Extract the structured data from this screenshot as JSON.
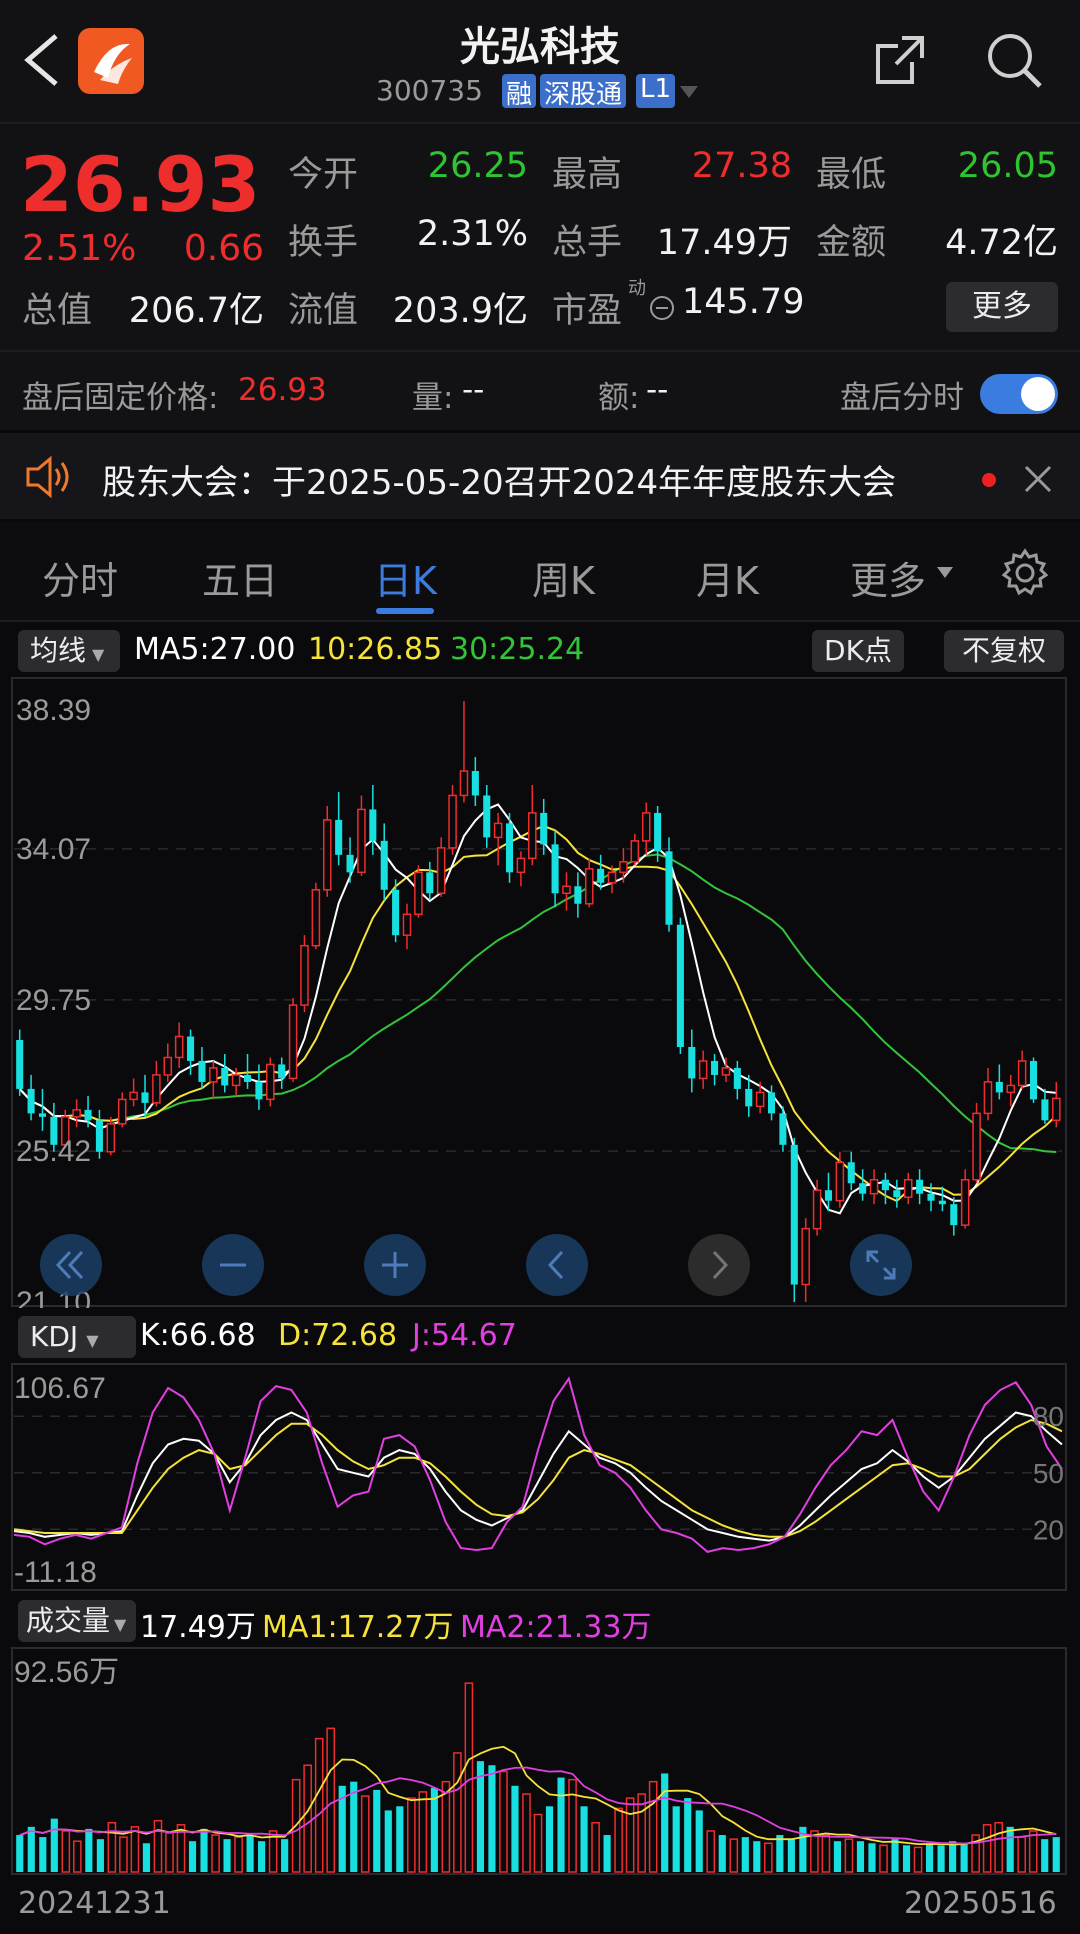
{
  "header": {
    "title": "光弘科技",
    "code": "300735",
    "badges": [
      "融",
      "深股通",
      "L1"
    ]
  },
  "quote": {
    "price": "26.93",
    "change_pct": "2.51%",
    "change": "0.66",
    "open_label": "今开",
    "open": "26.25",
    "high_label": "最高",
    "high": "27.38",
    "low_label": "最低",
    "low": "26.05",
    "turnover_label": "换手",
    "turnover": "2.31%",
    "volume_label": "总手",
    "volume": "17.49万",
    "amount_label": "金额",
    "amount": "4.72亿",
    "mktcap_label": "总值",
    "mktcap": "206.7亿",
    "float_label": "流值",
    "float": "203.9亿",
    "pe_label": "市盈",
    "pe_sup": "动",
    "pe": "145.79",
    "more_button": "更多"
  },
  "afterhours": {
    "price_label": "盘后固定价格:",
    "price": "26.93",
    "vol_label": "量:",
    "vol": "--",
    "amt_label": "额:",
    "amt": "--",
    "toggle_label": "盘后分时",
    "toggle_on": true
  },
  "notice": {
    "text": "股东大会：于2025-05-20召开2024年年度股东大会"
  },
  "tabs": [
    {
      "label": "分时"
    },
    {
      "label": "五日"
    },
    {
      "label": "日K",
      "active": true
    },
    {
      "label": "周K"
    },
    {
      "label": "月K"
    },
    {
      "label": "更多"
    }
  ],
  "ma_bar": {
    "selector": "均线",
    "ma5": "MA5:27.00",
    "ma10": "10:26.85",
    "ma30": "30:25.24",
    "dk_button": "DK点",
    "adjust_button": "不复权"
  },
  "kdj_bar": {
    "selector": "KDJ",
    "k": "K:66.68",
    "d": "D:72.68",
    "j": "J:54.67"
  },
  "vol_bar": {
    "selector": "成交量",
    "value": "17.49万",
    "ma1": "MA1:17.27万",
    "ma2": "MA2:21.33万"
  },
  "colors": {
    "up": "#ee2d2d",
    "down": "#19e0e0",
    "ma5": "#ffffff",
    "ma10": "#f5e23a",
    "ma30": "#34c43a",
    "accent": "#3b7ce0",
    "k": "#ffffff",
    "d": "#f5e23a",
    "j": "#e040e0"
  },
  "icons": [
    "back-arrow-icon",
    "app-logo-icon",
    "share-icon",
    "search-icon",
    "speaker-icon",
    "close-icon",
    "settings-gear-icon",
    "rewind-icon",
    "zoom-out-icon",
    "zoom-in-icon",
    "pan-left-icon",
    "pan-right-icon",
    "fullscreen-icon"
  ],
  "chart_data": [
    {
      "type": "candlestick",
      "name": "日K",
      "ylim": [
        21.1,
        38.39
      ],
      "y_ticks": [
        "38.39",
        "34.07",
        "29.75",
        "25.42",
        "21.10"
      ],
      "x_range": [
        "20241231",
        "20250516"
      ],
      "ohlc": [
        [
          28.6,
          28.9,
          27.0,
          27.2
        ],
        [
          27.2,
          27.6,
          26.3,
          26.5
        ],
        [
          26.5,
          27.2,
          26.0,
          26.4
        ],
        [
          26.4,
          26.8,
          25.4,
          25.6
        ],
        [
          25.6,
          26.6,
          25.5,
          26.4
        ],
        [
          26.4,
          26.9,
          26.1,
          26.6
        ],
        [
          26.6,
          27.0,
          26.1,
          26.3
        ],
        [
          26.3,
          26.6,
          25.2,
          25.4
        ],
        [
          25.4,
          26.4,
          25.3,
          26.2
        ],
        [
          26.2,
          27.1,
          26.1,
          26.9
        ],
        [
          26.9,
          27.5,
          26.7,
          27.1
        ],
        [
          27.1,
          27.6,
          26.4,
          26.8
        ],
        [
          26.8,
          28.0,
          26.7,
          27.6
        ],
        [
          27.6,
          28.5,
          27.4,
          28.1
        ],
        [
          28.1,
          29.1,
          27.8,
          28.7
        ],
        [
          28.7,
          28.9,
          27.6,
          28.0
        ],
        [
          28.0,
          28.4,
          27.2,
          27.4
        ],
        [
          27.4,
          28.0,
          26.9,
          27.8
        ],
        [
          27.8,
          28.2,
          27.1,
          27.3
        ],
        [
          27.3,
          27.8,
          27.0,
          27.6
        ],
        [
          27.6,
          28.2,
          27.2,
          27.4
        ],
        [
          27.4,
          27.9,
          26.6,
          26.9
        ],
        [
          26.9,
          28.1,
          26.7,
          27.9
        ],
        [
          27.9,
          28.1,
          27.2,
          27.5
        ],
        [
          27.5,
          29.8,
          27.4,
          29.6
        ],
        [
          29.6,
          31.6,
          29.4,
          31.3
        ],
        [
          31.3,
          33.1,
          31.2,
          32.9
        ],
        [
          32.9,
          35.3,
          32.7,
          34.9
        ],
        [
          34.9,
          35.7,
          33.6,
          33.9
        ],
        [
          33.9,
          34.4,
          33.1,
          33.4
        ],
        [
          33.4,
          35.6,
          33.3,
          35.2
        ],
        [
          35.2,
          35.9,
          33.9,
          34.3
        ],
        [
          34.3,
          34.8,
          32.6,
          32.9
        ],
        [
          32.9,
          33.2,
          31.4,
          31.6
        ],
        [
          31.6,
          32.5,
          31.2,
          32.2
        ],
        [
          32.2,
          33.6,
          32.1,
          33.4
        ],
        [
          33.4,
          33.7,
          32.6,
          32.8
        ],
        [
          32.8,
          34.4,
          32.7,
          34.1
        ],
        [
          34.1,
          35.9,
          33.9,
          35.6
        ],
        [
          35.6,
          38.3,
          35.4,
          36.3
        ],
        [
          36.3,
          36.7,
          35.3,
          35.6
        ],
        [
          35.6,
          35.9,
          34.1,
          34.4
        ],
        [
          34.4,
          35.1,
          33.6,
          34.8
        ],
        [
          34.8,
          35.1,
          33.1,
          33.4
        ],
        [
          33.4,
          34.0,
          33.0,
          33.8
        ],
        [
          33.8,
          35.9,
          33.6,
          35.1
        ],
        [
          35.1,
          35.5,
          33.9,
          34.2
        ],
        [
          34.2,
          34.6,
          32.4,
          32.8
        ],
        [
          32.8,
          33.4,
          32.3,
          33.0
        ],
        [
          33.0,
          33.4,
          32.1,
          32.5
        ],
        [
          32.5,
          33.8,
          32.4,
          33.5
        ],
        [
          33.5,
          33.9,
          32.9,
          33.1
        ],
        [
          33.1,
          33.6,
          32.8,
          33.4
        ],
        [
          33.4,
          34.1,
          33.1,
          33.7
        ],
        [
          33.7,
          34.5,
          33.6,
          34.3
        ],
        [
          34.3,
          35.4,
          33.9,
          35.1
        ],
        [
          35.1,
          35.3,
          33.7,
          34.0
        ],
        [
          34.0,
          34.4,
          31.7,
          31.9
        ],
        [
          31.9,
          32.1,
          28.2,
          28.4
        ],
        [
          28.4,
          28.9,
          27.1,
          27.5
        ],
        [
          27.5,
          28.3,
          27.2,
          28.0
        ],
        [
          28.0,
          28.2,
          27.3,
          27.6
        ],
        [
          27.6,
          28.1,
          27.4,
          27.8
        ],
        [
          27.8,
          28.0,
          26.9,
          27.2
        ],
        [
          27.2,
          27.6,
          26.4,
          26.7
        ],
        [
          26.7,
          27.4,
          26.5,
          27.1
        ],
        [
          27.1,
          27.3,
          26.3,
          26.5
        ],
        [
          26.5,
          26.7,
          25.4,
          25.6
        ],
        [
          25.6,
          25.8,
          21.1,
          21.6
        ],
        [
          21.6,
          23.5,
          21.1,
          23.2
        ],
        [
          23.2,
          24.6,
          23.0,
          24.3
        ],
        [
          24.3,
          24.8,
          23.7,
          24.0
        ],
        [
          24.0,
          25.4,
          23.8,
          25.1
        ],
        [
          25.1,
          25.4,
          24.3,
          24.5
        ],
        [
          24.5,
          24.9,
          24.0,
          24.2
        ],
        [
          24.2,
          24.9,
          23.9,
          24.6
        ],
        [
          24.6,
          24.8,
          23.9,
          24.3
        ],
        [
          24.3,
          24.6,
          23.8,
          24.1
        ],
        [
          24.1,
          24.8,
          23.9,
          24.6
        ],
        [
          24.6,
          24.9,
          23.9,
          24.2
        ],
        [
          24.2,
          24.5,
          23.7,
          24.0
        ],
        [
          24.0,
          24.4,
          23.7,
          23.9
        ],
        [
          23.9,
          24.1,
          23.0,
          23.3
        ],
        [
          23.3,
          24.9,
          23.2,
          24.6
        ],
        [
          24.6,
          26.8,
          24.5,
          26.5
        ],
        [
          26.5,
          27.8,
          26.3,
          27.4
        ],
        [
          27.4,
          27.9,
          26.9,
          27.1
        ],
        [
          27.1,
          27.6,
          26.7,
          27.3
        ],
        [
          27.3,
          28.3,
          27.2,
          28.0
        ],
        [
          28.0,
          28.1,
          26.8,
          26.9
        ],
        [
          26.9,
          27.2,
          26.2,
          26.3
        ],
        [
          26.3,
          27.4,
          26.1,
          26.93
        ]
      ]
    },
    {
      "type": "line",
      "name": "KDJ",
      "ylim": [
        -11.18,
        106.67
      ],
      "y_ticks": [
        "106.67",
        "-11.18"
      ],
      "right_ticks": [
        "80",
        "50",
        "20"
      ],
      "series": [
        {
          "name": "K",
          "values": [
            19,
            18,
            16,
            17,
            18,
            17,
            18,
            19,
            38,
            55,
            65,
            68,
            67,
            60,
            45,
            55,
            70,
            78,
            82,
            78,
            65,
            52,
            50,
            48,
            58,
            62,
            60,
            52,
            40,
            30,
            25,
            22,
            26,
            30,
            45,
            60,
            72,
            65,
            58,
            55,
            50,
            42,
            35,
            30,
            25,
            20,
            18,
            16,
            15,
            14,
            16,
            22,
            30,
            38,
            45,
            52,
            55,
            62,
            56,
            48,
            42,
            48,
            58,
            68,
            75,
            82,
            80,
            72,
            65
          ]
        },
        {
          "name": "D",
          "values": [
            20,
            19,
            18,
            18,
            18,
            18,
            18,
            18,
            30,
            42,
            52,
            58,
            62,
            60,
            52,
            54,
            62,
            70,
            76,
            76,
            70,
            62,
            56,
            52,
            54,
            58,
            58,
            55,
            48,
            40,
            33,
            28,
            27,
            29,
            36,
            46,
            58,
            62,
            60,
            57,
            54,
            48,
            42,
            36,
            30,
            26,
            22,
            19,
            17,
            16,
            16,
            19,
            24,
            30,
            36,
            42,
            48,
            54,
            55,
            52,
            48,
            48,
            52,
            60,
            68,
            74,
            78,
            76,
            72
          ]
        },
        {
          "name": "J",
          "values": [
            17,
            16,
            12,
            15,
            17,
            15,
            18,
            21,
            55,
            82,
            95,
            90,
            78,
            60,
            30,
            58,
            88,
            96,
            94,
            82,
            55,
            32,
            38,
            40,
            68,
            70,
            64,
            46,
            24,
            10,
            9,
            10,
            24,
            32,
            62,
            88,
            100,
            70,
            54,
            50,
            42,
            30,
            20,
            18,
            15,
            8,
            10,
            9,
            10,
            12,
            16,
            28,
            42,
            54,
            62,
            72,
            70,
            78,
            58,
            40,
            30,
            48,
            70,
            86,
            94,
            98,
            86,
            64,
            52
          ]
        }
      ]
    },
    {
      "type": "bar",
      "name": "成交量",
      "ylim": [
        0,
        92.56
      ],
      "y_ticks": [
        "92.56万"
      ],
      "values": [
        18,
        22,
        17,
        26,
        20,
        15,
        21,
        16,
        24,
        17,
        22,
        14,
        25,
        19,
        23,
        15,
        21,
        18,
        16,
        17,
        18,
        15,
        20,
        16,
        45,
        52,
        65,
        70,
        42,
        44,
        37,
        40,
        30,
        32,
        36,
        39,
        41,
        44,
        58,
        92,
        54,
        52,
        49,
        42,
        38,
        28,
        32,
        46,
        45,
        32,
        24,
        18,
        31,
        36,
        38,
        44,
        48,
        32,
        36,
        30,
        20,
        18,
        16,
        17,
        15,
        14,
        18,
        16,
        22,
        20,
        18,
        15,
        16,
        15,
        14,
        13,
        16,
        13,
        12,
        14,
        13,
        15,
        14,
        18,
        23,
        24,
        22,
        17,
        20,
        16,
        17
      ]
    }
  ]
}
